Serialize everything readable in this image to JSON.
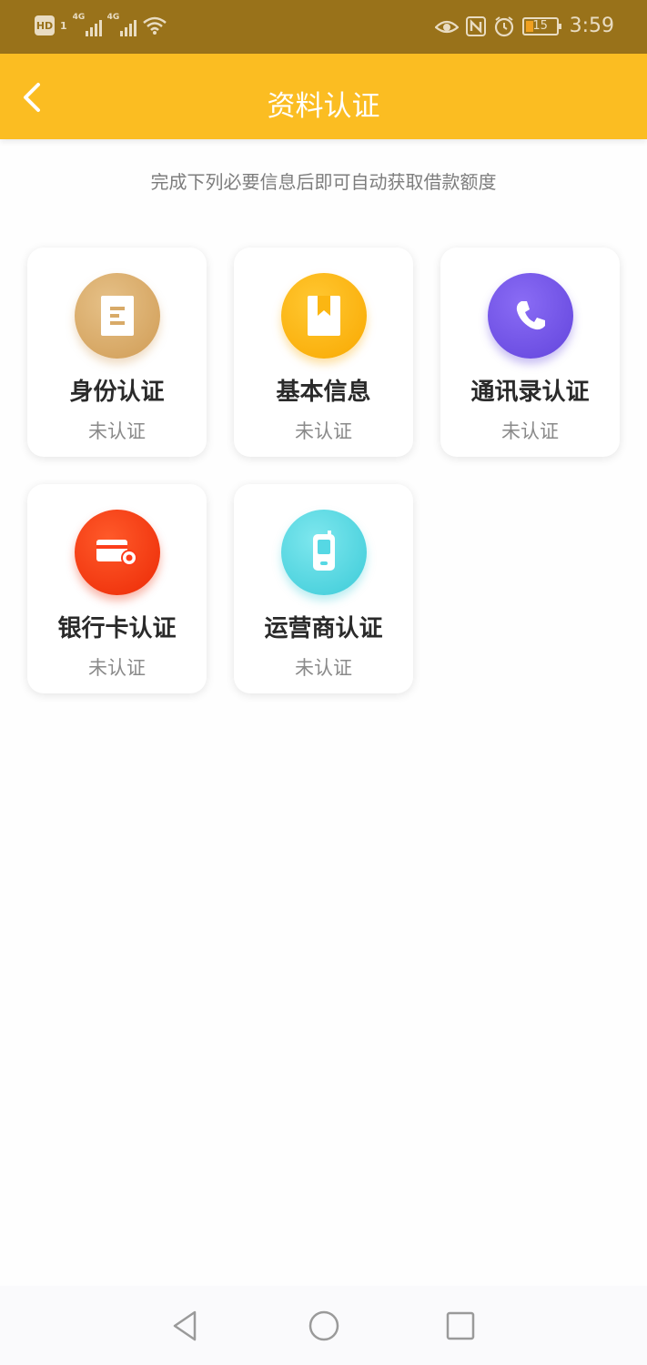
{
  "status_bar": {
    "hd_label": "HD",
    "sim_number": "1",
    "network_1": "4G",
    "network_2": "4G",
    "battery_level": "15",
    "time": "3:59",
    "icons": [
      "hd-icon",
      "signal-icon",
      "signal-icon",
      "wifi-icon",
      "eye-icon",
      "nfc-icon",
      "alarm-icon",
      "battery-icon"
    ]
  },
  "header": {
    "title": "资料认证",
    "background": "#fbbd22"
  },
  "subtitle": "完成下列必要信息后即可自动获取借款额度",
  "cards": [
    {
      "title": "身份认证",
      "status": "未认证",
      "icon": "id-card-icon",
      "color": "#d8aa68"
    },
    {
      "title": "基本信息",
      "status": "未认证",
      "icon": "bookmark-icon",
      "color": "#fbb612"
    },
    {
      "title": "通讯录认证",
      "status": "未认证",
      "icon": "phone-icon",
      "color": "#7357e8"
    },
    {
      "title": "银行卡认证",
      "status": "未认证",
      "icon": "bank-card-icon",
      "color": "#fc3d1a"
    },
    {
      "title": "运营商认证",
      "status": "未认证",
      "icon": "mobile-icon",
      "color": "#56d8e4"
    }
  ],
  "nav_bar": {
    "buttons": [
      "back-triangle-icon",
      "home-circle-icon",
      "recents-square-icon"
    ]
  }
}
